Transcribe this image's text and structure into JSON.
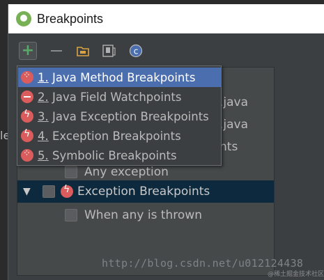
{
  "window": {
    "title": "Breakpoints"
  },
  "toolbar": {
    "add_label": "+",
    "icons": [
      "add-icon",
      "remove-icon",
      "folder-icon",
      "file-icon",
      "class-icon"
    ]
  },
  "background": {
    "left_char": "le"
  },
  "tree": {
    "partial_texts": [
      ".java",
      ".java",
      "nts"
    ],
    "rows": [
      {
        "label": "Any exception",
        "checked": false
      },
      {
        "label": "Exception Breakpoints",
        "checked": false,
        "expanded": true,
        "selected": true
      },
      {
        "label": "When any is thrown",
        "checked": false
      }
    ]
  },
  "menu": {
    "items": [
      {
        "num": "1.",
        "label": " Java Method Breakpoints",
        "icon": "method-breakpoint-icon"
      },
      {
        "num": "2.",
        "label": " Java Field Watchpoints",
        "icon": "field-watchpoint-icon"
      },
      {
        "num": "3.",
        "label": " Java Exception Breakpoints",
        "icon": "exception-breakpoint-icon"
      },
      {
        "num": "4.",
        "label": " Exception Breakpoints",
        "icon": "exception-breakpoint-icon"
      },
      {
        "num": "5.",
        "label": " Symbolic Breakpoints",
        "icon": "symbolic-breakpoint-icon"
      }
    ]
  },
  "watermark": {
    "text": "http://blog.csdn.net/u012124438",
    "badge": "@稀土掘金技术社区"
  },
  "colors": {
    "accent": "#4b6eaf",
    "breakpoint": "#db5c5c",
    "add": "#59a869",
    "selected_row": "#0d293e"
  }
}
